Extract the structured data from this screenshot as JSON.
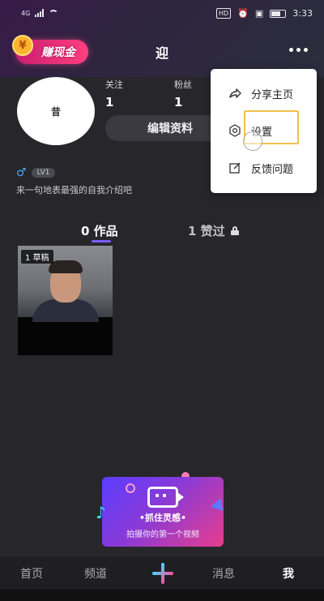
{
  "status_bar": {
    "carrier": "4G",
    "hd_label": "HD",
    "battery_level": 0.7,
    "time": "3:33"
  },
  "header": {
    "earn_badge_label": "赚现金",
    "earn_badge_coin": "¥",
    "title": "迎"
  },
  "profile": {
    "avatar_mark": "昔",
    "follow_label": "关注",
    "follow_count": "1",
    "fans_label": "粉丝",
    "fans_count": "1",
    "edit_button_label": "编辑资料",
    "gender_symbol": "♂",
    "level": "LV1",
    "bio": "来一句地表最强的自我介绍吧"
  },
  "tabs": {
    "works_label": "0 作品",
    "liked_label": "1 赞过"
  },
  "grid": {
    "draft_label": "1 草稿"
  },
  "menu": {
    "items": [
      {
        "label": "分享主页",
        "icon": "share-icon"
      },
      {
        "label": "设置",
        "icon": "gear-icon"
      },
      {
        "label": "反馈问题",
        "icon": "edit-icon"
      }
    ]
  },
  "promo": {
    "title": "•抓住灵感•",
    "subtitle": "拍摄你的第一个视频"
  },
  "bottom_nav": {
    "home": "首页",
    "channel": "频道",
    "message": "消息",
    "me": "我"
  },
  "colors": {
    "accent": "#7a5cff",
    "badge": "#ff3f7e",
    "highlight": "#f0c24a"
  }
}
